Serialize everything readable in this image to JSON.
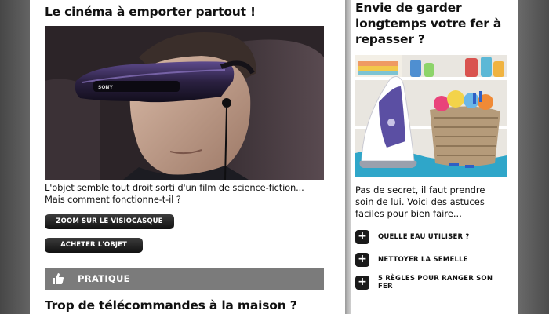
{
  "article_main": {
    "title": "Le cinéma à emporter partout !",
    "caption": "L'objet semble tout droit sorti d'un film de science-fiction... Mais comment fonctionne-t-il ?",
    "buttons": {
      "zoom": "ZOOM SUR LE VISIOCASQUE",
      "buy": "ACHETER L'OBJET"
    },
    "image_brand": "SONY"
  },
  "section": {
    "label": "PRATIQUE",
    "icon": "thumbs-up-icon"
  },
  "article_second": {
    "title": "Trop de télécommandes à la maison ?"
  },
  "sidebar": {
    "title": "Envie de garder longtemps votre fer à repasser ?",
    "description": "Pas de secret, il faut prendre soin de lui. Voici des astuces faciles pour bien faire...",
    "links": [
      {
        "label": "QUELLE EAU UTILISER ?",
        "icon": "plus-icon"
      },
      {
        "label": "NETTOYER LA SEMELLE",
        "icon": "plus-icon"
      },
      {
        "label": "5 RÈGLES POUR RANGER SON FER",
        "icon": "plus-icon"
      }
    ]
  },
  "colors": {
    "background": "#5a5a5a",
    "section_bar": "#7b7b7b",
    "button": "#1a1a1a"
  }
}
